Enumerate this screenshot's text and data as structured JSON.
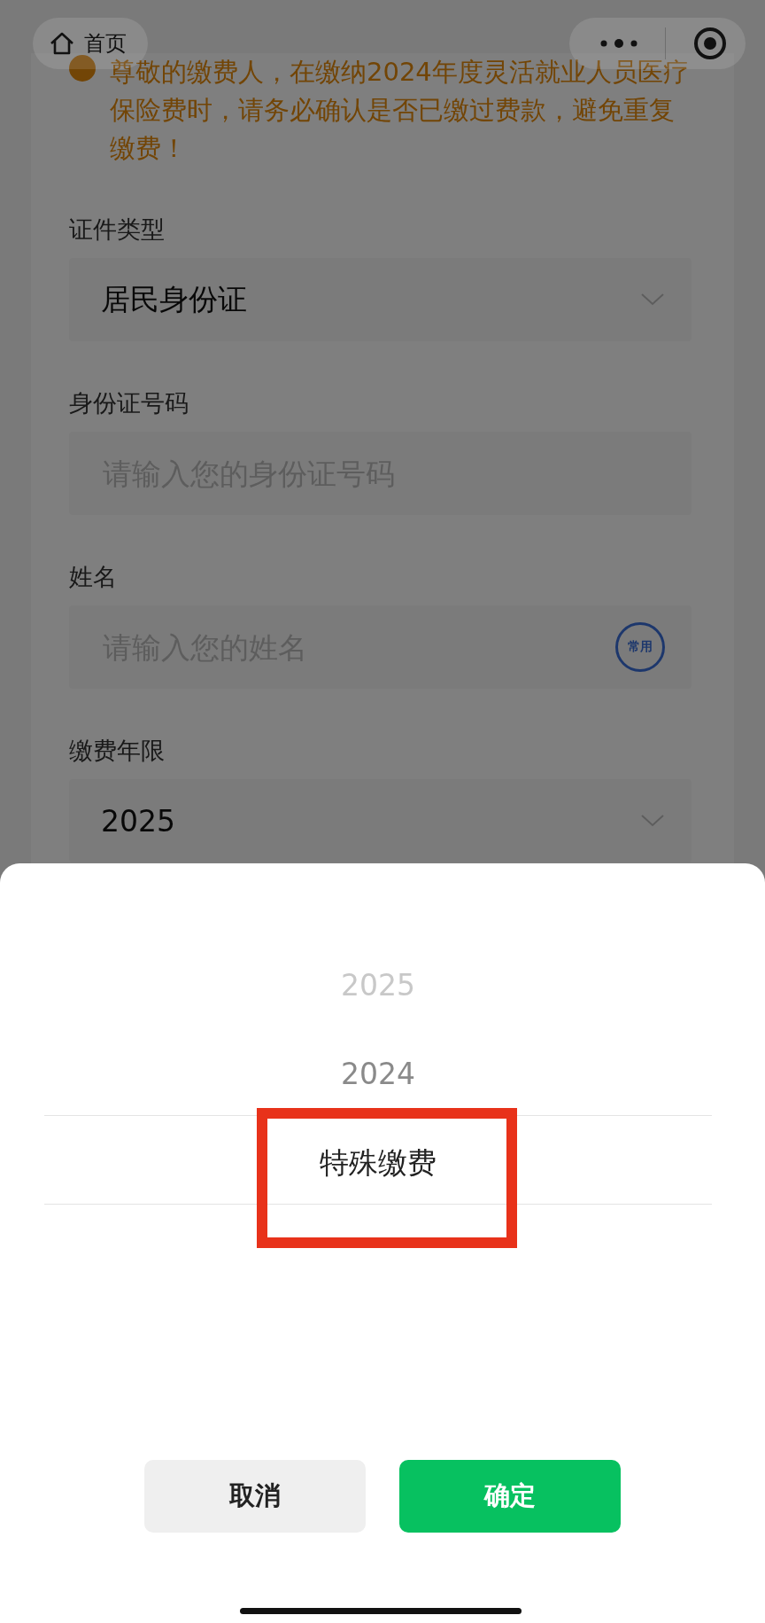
{
  "nav": {
    "home_label": "首页"
  },
  "notice": {
    "text": "尊敬的缴费人，在缴纳2024年度灵活就业人员医疗保险费时，请务必确认是否已缴过费款，避免重复缴费！"
  },
  "form": [
    {
      "label": "证件类型",
      "kind": "select",
      "value": "居民身份证"
    },
    {
      "label": "身份证号码",
      "kind": "input",
      "placeholder": "请输入您的身份证号码"
    },
    {
      "label": "姓名",
      "kind": "input",
      "placeholder": "请输入您的姓名",
      "badge": "常用"
    },
    {
      "label": "缴费年限",
      "kind": "select",
      "value": "2025"
    }
  ],
  "picker": {
    "options": [
      {
        "label": "2025",
        "selected": false
      },
      {
        "label": "2024",
        "selected": false
      },
      {
        "label": "特殊缴费",
        "selected": true
      }
    ],
    "buttons": [
      {
        "label": "取消",
        "kind": "cancel"
      },
      {
        "label": "确定",
        "kind": "confirm"
      }
    ]
  }
}
